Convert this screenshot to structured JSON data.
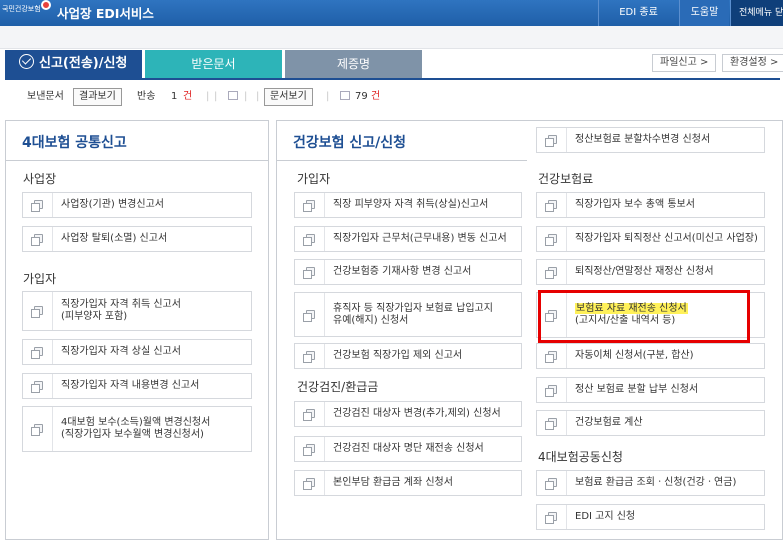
{
  "header": {
    "logo_text": "국민건강보험",
    "app_title": "사업장 EDI서비스",
    "edi_end": "EDI 종료",
    "help": "도움말",
    "all_menu": "전체메뉴 닫기"
  },
  "tabs": {
    "main": "신고(전송)/신청",
    "received": "받은문서",
    "certificate": "제증명"
  },
  "tools": {
    "file_report": "파일신고 >",
    "settings": "환경설정 >"
  },
  "subbar": {
    "sent_label": "보낸문서",
    "result_btn": "결과보기",
    "returned_label": "반송",
    "returned_count": "1",
    "returned_unit": "건",
    "doc_btn": "문서보기",
    "doc_count": "79",
    "doc_unit": "건"
  },
  "left": {
    "title": "4대보험 공통신고",
    "sec_workplace": "사업장",
    "workplace_items": [
      "사업장(기관) 변경신고서",
      "사업장 탈퇴(소멸) 신고서"
    ],
    "sec_subscriber": "가입자",
    "subscriber_items": [
      {
        "l1": "직장가입자 자격 취득 신고서",
        "l2": "(피부양자 포함)"
      },
      {
        "l1": "직장가입자 자격 상실 신고서",
        "l2": ""
      },
      {
        "l1": "직장가입자 자격 내용변경 신고서",
        "l2": ""
      },
      {
        "l1": "4대보험 보수(소득)월액 변경신청서",
        "l2": "(직장가입자 보수월액 변경신청서)"
      }
    ]
  },
  "right": {
    "title": "건강보험 신고/신청",
    "top_item": "정산보험료 분할차수변경 신청서",
    "sec_subscriber": "가입자",
    "subscriber_items": [
      {
        "l1": "직장 피부양자 자격 취득(상실)신고서",
        "l2": ""
      },
      {
        "l1": "직장가입자 근무처(근무내용) 변동 신고서",
        "l2": ""
      },
      {
        "l1": "건강보험증 기재사항 변경 신고서",
        "l2": ""
      },
      {
        "l1": "휴직자 등 직장가입자 보험료 납입고지",
        "l2": "유예(해지) 신청서"
      },
      {
        "l1": "건강보험 직장가입 제외 신고서",
        "l2": ""
      }
    ],
    "sec_checkup": "건강검진/환급금",
    "checkup_items": [
      "건강검진 대상자 변경(추가,제외) 신청서",
      "건강검진 대상자 명단 재전송 신청서",
      "본인부담 환급금 계좌 신청서"
    ],
    "sec_premium": "건강보험료",
    "premium_items": [
      {
        "l1": "직장가입자 보수 총액 통보서",
        "l2": ""
      },
      {
        "l1": "직장가입자 퇴직정산 신고서(미신고 사업장)",
        "l2": ""
      },
      {
        "l1": "퇴직정산/연말정산 재정산 신청서",
        "l2": ""
      },
      {
        "l1": "보험료 자료 재전송 신청서",
        "l2": "(고지서/산출 내역서 등)"
      },
      {
        "l1": "자동이체 신청서(구분, 합산)",
        "l2": ""
      },
      {
        "l1": "정산 보험료 분할 납부 신청서",
        "l2": ""
      },
      {
        "l1": "건강보험료 계산",
        "l2": ""
      }
    ],
    "sec_common": "4대보험공동신청",
    "common_items": [
      "보험료 환급금 조회ㆍ신청(건강ㆍ연금)",
      "EDI 고지 신청"
    ]
  },
  "colors": {
    "header_blue": "#1f5fa8",
    "tab_main": "#1e4f93",
    "tab_received": "#2db4b8",
    "tab_cert": "#7f93a8",
    "highlight": "#fff15a",
    "redbox": "#e60000"
  }
}
